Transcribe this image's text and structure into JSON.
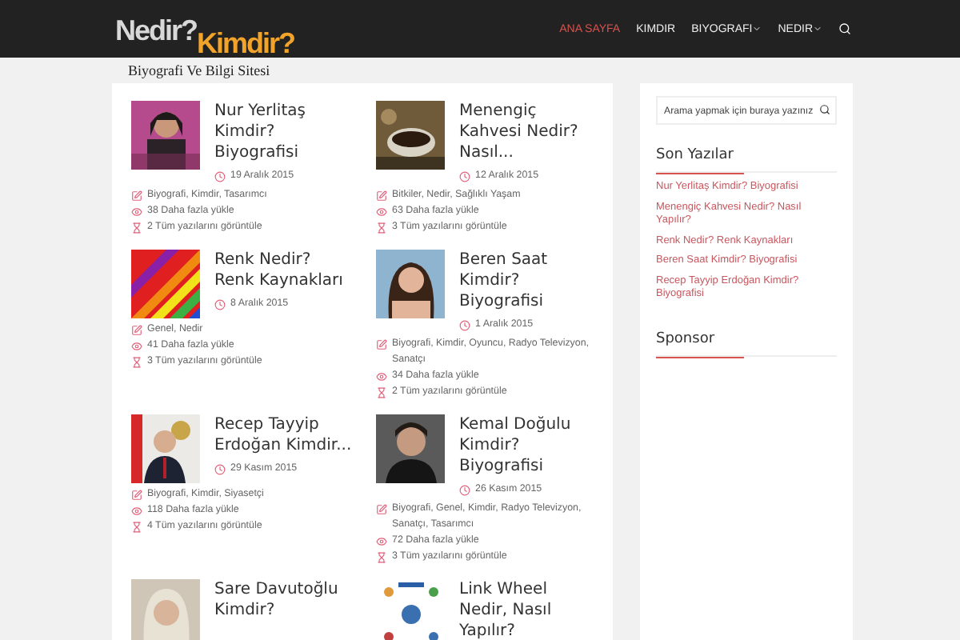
{
  "logo": {
    "word_1": "Nedir?",
    "word_2": "Kimdir?",
    "tagline": "Biyografi Ve Bilgi Sitesi"
  },
  "nav": [
    {
      "label": "ANA SAYFA",
      "selected": true,
      "kind": "link"
    },
    {
      "label": "KIMDIR",
      "selected": false,
      "kind": "link"
    },
    {
      "label": "BIYOGRAFI",
      "selected": false,
      "kind": "dropdown"
    },
    {
      "label": "NEDIR",
      "selected": false,
      "kind": "dropdown"
    }
  ],
  "posts": [
    {
      "title": "Nur Yerlitaş Kimdir? Biyografisi",
      "date": "19 Aralık 2015",
      "categories": "Biyografi, Kimdir, Tasarımcı",
      "views": "38 Daha fazla yükle",
      "pages": "2 Tüm yazılarını görüntüle"
    },
    {
      "title": "Menengiç Kahvesi Nedir? Nasıl...",
      "date": "12 Aralık 2015",
      "categories": "Bitkiler, Nedir, Sağlıklı Yaşam",
      "views": "63 Daha fazla yükle",
      "pages": "3 Tüm yazılarını görüntüle"
    },
    {
      "title": "Renk Nedir? Renk Kaynakları",
      "date": "8 Aralık 2015",
      "categories": "Genel, Nedir",
      "views": "41 Daha fazla yükle",
      "pages": "3 Tüm yazılarını görüntüle"
    },
    {
      "title": "Beren Saat Kimdir? Biyografisi",
      "date": "1 Aralık 2015",
      "categories": "Biyografi, Kimdir, Oyuncu, Radyo Televizyon, Sanatçı",
      "views": "34 Daha fazla yükle",
      "pages": "2 Tüm yazılarını görüntüle"
    },
    {
      "title": "Recep Tayyip Erdoğan Kimdir...",
      "date": "29 Kasım 2015",
      "categories": "Biyografi, Kimdir, Siyasetçi",
      "views": "118 Daha fazla yükle",
      "pages": "4 Tüm yazılarını görüntüle"
    },
    {
      "title": "Kemal Doğulu Kimdir? Biyografisi",
      "date": "26 Kasım 2015",
      "categories": "Biyografi, Genel, Kimdir, Radyo Televizyon, Sanatçı, Tasarımcı",
      "views": "72 Daha fazla yükle",
      "pages": "3 Tüm yazılarını görüntüle"
    },
    {
      "title": "Sare Davutoğlu Kimdir?"
    },
    {
      "title": "Link Wheel Nedir, Nasıl Yapılır?"
    }
  ],
  "sidebar": {
    "search": {
      "placeholder": "Arama yapmak için buraya yazınız"
    },
    "recent_title": "Son Yazılar",
    "recent": [
      "Nur Yerlitaş Kimdir? Biyografisi",
      "Menengiç Kahvesi Nedir? Nasıl Yapılır?",
      "Renk Nedir? Renk Kaynakları",
      "Beren Saat Kimdir? Biyografisi",
      "Recep Tayyip Erdoğan Kimdir? Biyografisi"
    ],
    "sponsor_title": "Sponsor"
  }
}
